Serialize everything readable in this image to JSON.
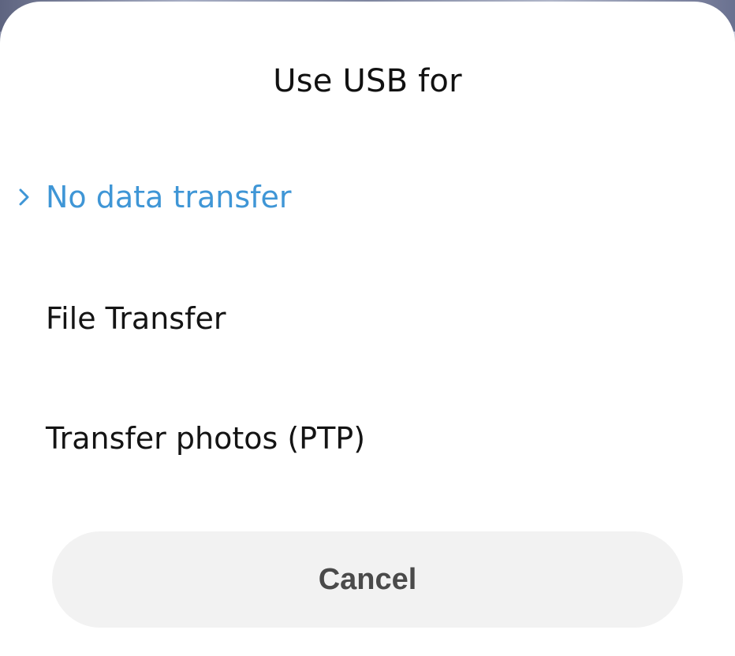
{
  "dialog": {
    "title": "Use USB for",
    "options": [
      {
        "label": "No data transfer",
        "selected": true
      },
      {
        "label": "File Transfer",
        "selected": false
      },
      {
        "label": "Transfer photos (PTP)",
        "selected": false
      }
    ],
    "cancel_label": "Cancel"
  },
  "colors": {
    "accent": "#3f96d6",
    "text": "#141414",
    "sheet_background": "#ffffff",
    "cancel_background": "#f2f2f2"
  },
  "icons": {
    "selected_indicator": "chevron-right-icon"
  }
}
